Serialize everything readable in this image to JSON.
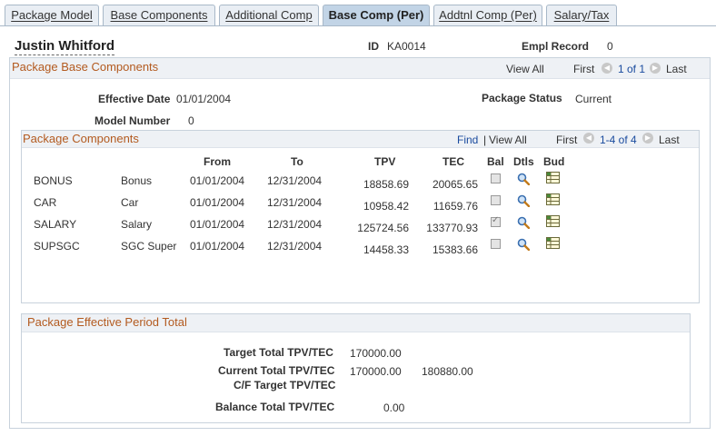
{
  "tabs": [
    {
      "label": "Package Model"
    },
    {
      "label": "Base Components"
    },
    {
      "label": "Additional Comp"
    },
    {
      "label": "Base Comp (Per)"
    },
    {
      "label": "Addtnl Comp (Per)"
    },
    {
      "label": "Salary/Tax"
    }
  ],
  "header": {
    "employee_name": "Justin Whitford",
    "id_label": "ID",
    "id_value": "KA0014",
    "empl_record_label": "Empl Record",
    "empl_record_value": "0"
  },
  "package_base": {
    "title": "Package Base Components",
    "view_all": "View All",
    "first": "First",
    "range": "1 of 1",
    "last": "Last",
    "effective_date_label": "Effective Date",
    "effective_date_value": "01/01/2004",
    "package_status_label": "Package Status",
    "package_status_value": "Current",
    "model_number_label": "Model Number",
    "model_number_value": "0"
  },
  "components": {
    "title": "Package Components",
    "find": "Find",
    "separator": "|",
    "view_all": "View All",
    "first": "First",
    "range": "1-4 of 4",
    "last": "Last",
    "columns": {
      "from": "From",
      "to": "To",
      "tpv": "TPV",
      "tec": "TEC",
      "bal": "Bal",
      "dtls": "Dtls",
      "bud": "Bud"
    },
    "rows": [
      {
        "code": "BONUS",
        "desc": "Bonus",
        "from": "01/01/2004",
        "to": "12/31/2004",
        "tpv": "18858.69",
        "tec": "20065.65",
        "bal": false
      },
      {
        "code": "CAR",
        "desc": "Car",
        "from": "01/01/2004",
        "to": "12/31/2004",
        "tpv": "10958.42",
        "tec": "11659.76",
        "bal": false
      },
      {
        "code": "SALARY",
        "desc": "Salary",
        "from": "01/01/2004",
        "to": "12/31/2004",
        "tpv": "125724.56",
        "tec": "133770.93",
        "bal": true
      },
      {
        "code": "SUPSGC",
        "desc": "SGC Super",
        "from": "01/01/2004",
        "to": "12/31/2004",
        "tpv": "14458.33",
        "tec": "15383.66",
        "bal": false
      }
    ]
  },
  "totals": {
    "title": "Package Effective Period Total",
    "target_label": "Target Total TPV/TEC",
    "target_value": "170000.00",
    "current_label": "Current Total TPV/TEC",
    "current_tpv": "170000.00",
    "current_tec": "180880.00",
    "cf_label": "C/F Target TPV/TEC",
    "balance_label": "Balance Total TPV/TEC",
    "balance_value": "0.00"
  },
  "icons": {
    "details": "magnifier-icon",
    "budget": "budget-grid-icon",
    "prev": "arrow-left-icon",
    "next": "arrow-right-icon"
  }
}
